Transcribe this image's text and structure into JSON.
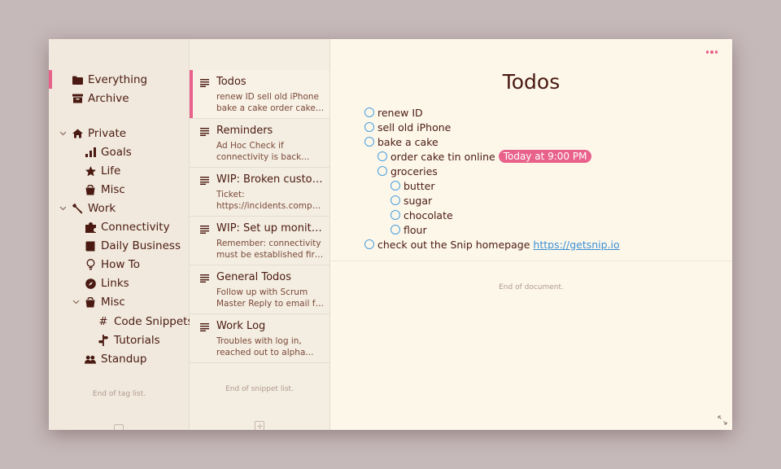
{
  "tags": {
    "items": [
      {
        "label": "Everything",
        "icon": "folder-icon"
      },
      {
        "label": "Archive",
        "icon": "archive-icon"
      },
      {
        "label": "Private",
        "icon": "house-icon"
      },
      {
        "label": "Goals",
        "icon": "bar-chart-icon"
      },
      {
        "label": "Life",
        "icon": "star-icon"
      },
      {
        "label": "Misc",
        "icon": "bucket-icon"
      },
      {
        "label": "Work",
        "icon": "wrench-icon"
      },
      {
        "label": "Connectivity",
        "icon": "puzzle-icon"
      },
      {
        "label": "Daily Business",
        "icon": "book-icon"
      },
      {
        "label": "How To",
        "icon": "lightbulb-icon"
      },
      {
        "label": "Links",
        "icon": "compass-icon"
      },
      {
        "label": "Misc",
        "icon": "bucket-icon"
      },
      {
        "label": "Code Snippets",
        "icon": "hash-icon"
      },
      {
        "label": "Tutorials",
        "icon": "signpost-icon"
      },
      {
        "label": "Standup",
        "icon": "people-icon"
      }
    ],
    "end_text": "End of tag list."
  },
  "snippets": {
    "items": [
      {
        "title": "Todos",
        "preview1": "renew ID sell old iPhone",
        "preview2": "bake a cake order cake tin online"
      },
      {
        "title": "Reminders",
        "preview1": "Ad Hoc Check if",
        "preview2": "connectivity is back..."
      },
      {
        "title": "WIP: Broken customer",
        "preview1": "Ticket:",
        "preview2": "https://incidents.company.com"
      },
      {
        "title": "WIP: Set up monitoring",
        "preview1": "Remember: connectivity",
        "preview2": "must be established first ..."
      },
      {
        "title": "General Todos",
        "preview1": "Follow up with Scrum",
        "preview2": "Master Reply to email from"
      },
      {
        "title": "Work Log",
        "preview1": "Troubles with log in,",
        "preview2": "reached out to alpha..."
      }
    ],
    "end_text": "End of snippet list."
  },
  "editor": {
    "title": "Todos",
    "todos": [
      {
        "text": "renew ID"
      },
      {
        "text": "sell old iPhone"
      },
      {
        "text": "bake a cake"
      },
      {
        "text": "order cake tin online",
        "badge": "Today at 9:00 PM"
      },
      {
        "text": "groceries"
      },
      {
        "text": "butter"
      },
      {
        "text": "sugar"
      },
      {
        "text": "chocolate"
      },
      {
        "text": "flour"
      },
      {
        "text": "check out the Snip homepage",
        "link": "https://getsnip.io"
      }
    ],
    "end_text": "End of document."
  },
  "colors": {
    "accent": "#e8628c",
    "checkbox": "#4a9fdc",
    "text": "#4a1a12"
  }
}
